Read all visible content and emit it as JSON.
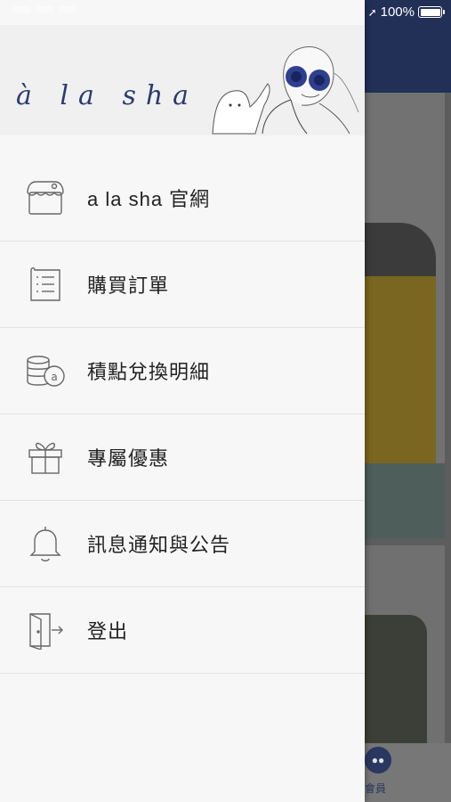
{
  "status_bar": {
    "battery": "100%"
  },
  "drawer": {
    "brand": "à la sha",
    "menu": [
      {
        "label": "a la sha 官網",
        "icon": "store-icon"
      },
      {
        "label": "購買訂單",
        "icon": "order-list-icon"
      },
      {
        "label": "積點兌換明細",
        "icon": "points-coins-icon"
      },
      {
        "label": "專屬優惠",
        "icon": "gift-icon"
      },
      {
        "label": "訊息通知與公告",
        "icon": "bell-icon"
      },
      {
        "label": "登出",
        "icon": "logout-icon"
      }
    ]
  },
  "background": {
    "tab_label": "會員"
  }
}
